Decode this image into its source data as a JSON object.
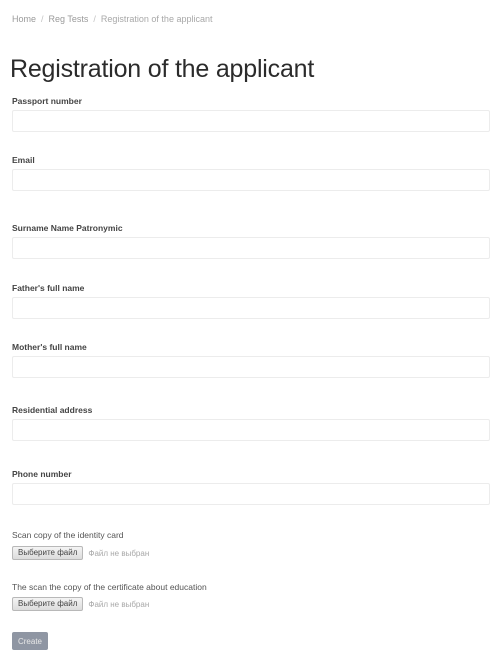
{
  "breadcrumb": {
    "items": [
      "Home",
      "Reg Tests",
      "Registration of the applicant"
    ]
  },
  "page": {
    "title": "Registration of the applicant"
  },
  "form": {
    "fields": [
      {
        "label": "Passport number",
        "value": "",
        "placeholder": ""
      },
      {
        "label": "Email",
        "value": "",
        "placeholder": ""
      },
      {
        "label": "Surname Name Patronymic",
        "value": "",
        "placeholder": ""
      },
      {
        "label": "Father's full name",
        "value": "",
        "placeholder": ""
      },
      {
        "label": "Mother's full name",
        "value": "",
        "placeholder": ""
      },
      {
        "label": "Residential address",
        "value": "",
        "placeholder": ""
      },
      {
        "label": "Phone number",
        "value": "",
        "placeholder": ""
      }
    ],
    "uploads": [
      {
        "label": "Scan copy of the identity card",
        "button": "Выберите файл",
        "status": "Файл не выбран"
      },
      {
        "label": "The scan the copy of the certificate about education",
        "button": "Выберите файл",
        "status": "Файл не выбран"
      }
    ],
    "submit_label": "Create"
  },
  "colors": {
    "submit_button": "#8f96a3",
    "title_text": "#2b2b2b",
    "input_border": "#ececec"
  }
}
